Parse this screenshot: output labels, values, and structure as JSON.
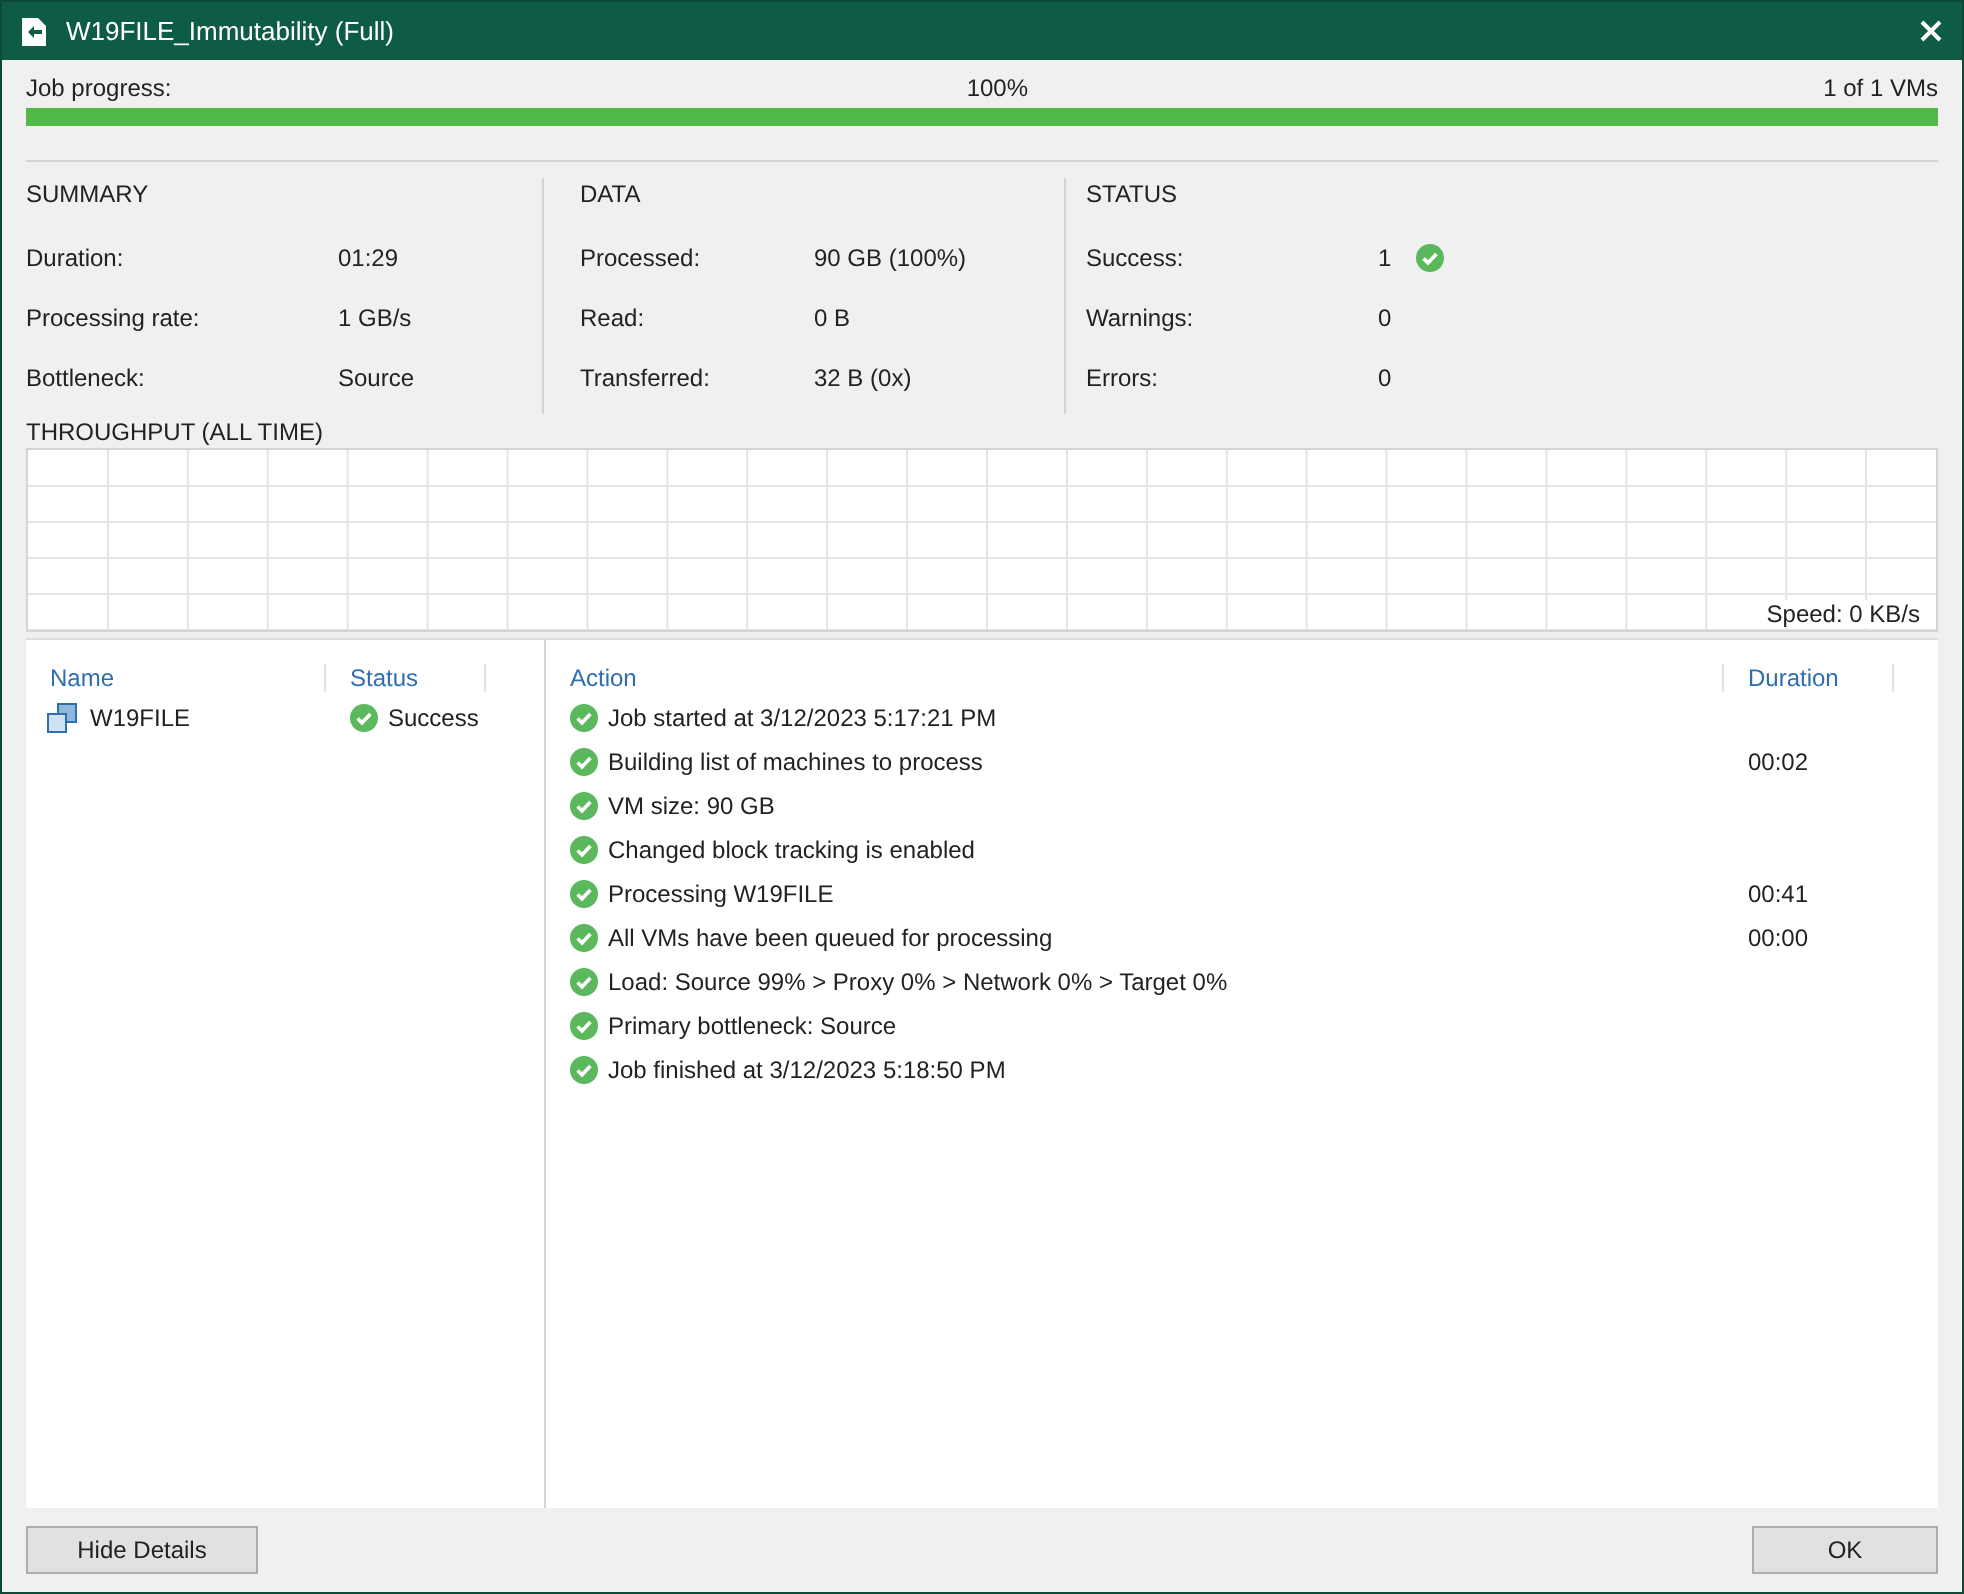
{
  "window": {
    "title": "W19FILE_Immutability (Full)"
  },
  "progress": {
    "label": "Job progress:",
    "percent": "100%",
    "count": "1 of 1 VMs",
    "level": 1
  },
  "sections": [
    {
      "title": "SUMMARY",
      "rows": [
        {
          "label": "Duration:",
          "value": "01:29",
          "kind": "plain"
        },
        {
          "label": "Processing rate:",
          "value": "1 GB/s",
          "kind": "plain"
        },
        {
          "label": "Bottleneck:",
          "value": "Source",
          "kind": "plain"
        }
      ]
    },
    {
      "title": "DATA",
      "rows": [
        {
          "label": "Processed:",
          "value": "90 GB (100%)",
          "kind": "plain"
        },
        {
          "label": "Read:",
          "value": "0 B",
          "kind": "plain"
        },
        {
          "label": "Transferred:",
          "value": "32 B (0x)",
          "kind": "plain"
        }
      ]
    },
    {
      "title": "STATUS",
      "rows": [
        {
          "label": "Success:",
          "value": "1",
          "kind": "success"
        },
        {
          "label": "Warnings:",
          "value": "0",
          "kind": "plain"
        },
        {
          "label": "Errors:",
          "value": "0",
          "kind": "plain"
        }
      ]
    }
  ],
  "throughput": {
    "title": "THROUGHPUT (ALL TIME)",
    "speed": "Speed: 0 KB/s"
  },
  "vm_table": {
    "columns": [
      "Name",
      "Status"
    ],
    "rows": [
      {
        "name": "W19FILE",
        "status": "Success",
        "kind": "success"
      }
    ]
  },
  "action_table": {
    "columns": [
      "Action",
      "Duration"
    ],
    "rows": [
      {
        "action": "Job started at 3/12/2023 5:17:21 PM",
        "duration": "",
        "kind": "success"
      },
      {
        "action": "Building list of machines to process",
        "duration": "00:02",
        "kind": "success"
      },
      {
        "action": "VM size: 90 GB",
        "duration": "",
        "kind": "success"
      },
      {
        "action": "Changed block tracking is enabled",
        "duration": "",
        "kind": "success"
      },
      {
        "action": "Processing W19FILE",
        "duration": "00:41",
        "kind": "success"
      },
      {
        "action": "All VMs have been queued for processing",
        "duration": "00:00",
        "kind": "success"
      },
      {
        "action": "Load: Source 99% > Proxy 0% > Network 0% > Target 0%",
        "duration": "",
        "kind": "success"
      },
      {
        "action": "Primary bottleneck: Source",
        "duration": "",
        "kind": "success"
      },
      {
        "action": "Job finished at 3/12/2023 5:18:50 PM",
        "duration": "",
        "kind": "success"
      }
    ]
  },
  "buttons": {
    "left": "Hide Details",
    "right": "OK"
  }
}
